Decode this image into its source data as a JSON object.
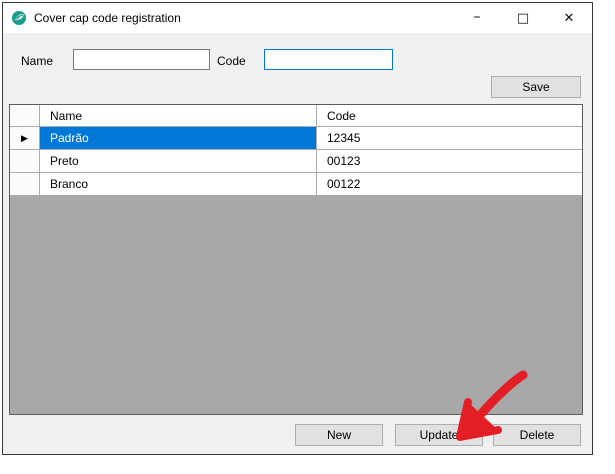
{
  "window": {
    "title": "Cover cap code registration",
    "controls": {
      "minimize": "–",
      "maximize": "□",
      "close": "✕"
    }
  },
  "form": {
    "name_label": "Name",
    "name_value": "",
    "code_label": "Code",
    "code_value": "",
    "save_label": "Save"
  },
  "grid": {
    "columns": [
      "Name",
      "Code"
    ],
    "row_pointer": "▶",
    "rows": [
      {
        "name": "Padrão",
        "code": "12345",
        "selected": true
      },
      {
        "name": "Preto",
        "code": "00123",
        "selected": false
      },
      {
        "name": "Branco",
        "code": "00122",
        "selected": false
      }
    ],
    "selected_cell": "Padrão"
  },
  "footer": {
    "new_label": "New",
    "update_label": "Update",
    "delete_label": "Delete"
  },
  "annotation": {
    "type": "hand-drawn-arrow",
    "target": "Update button",
    "color": "#E31E24"
  },
  "colors": {
    "selection": "#0078D7",
    "focused_input_border": "#0078D7",
    "grid_empty_background": "#A8A8A8",
    "form_background": "#F0F0F0",
    "titlebar_background": "#FFFFFF",
    "button_background": "#E1E1E1",
    "icon_teal": "#1D9C8C"
  }
}
